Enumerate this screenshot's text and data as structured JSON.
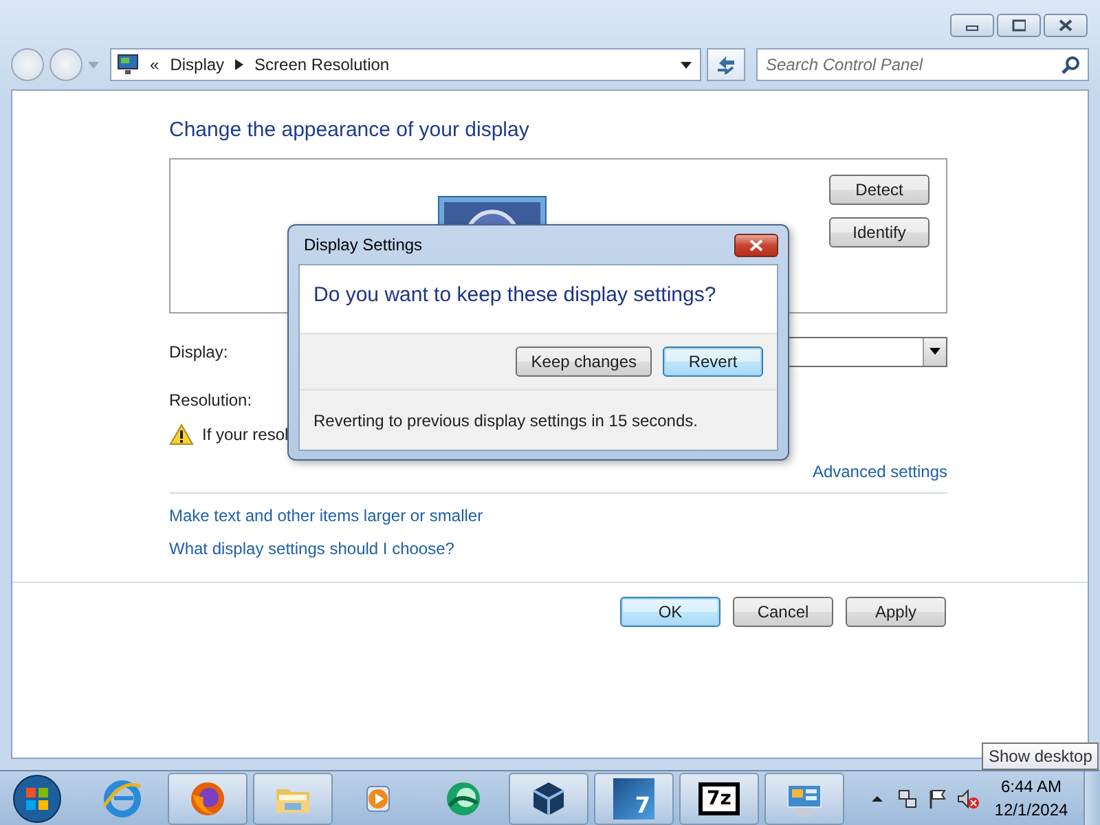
{
  "address_bar": {
    "overflow": "«",
    "breadcrumbs": [
      "Display",
      "Screen Resolution"
    ]
  },
  "search": {
    "placeholder": "Search Control Panel"
  },
  "heading": "Change the appearance of your display",
  "preview_buttons": [
    "Detect",
    "Identify"
  ],
  "fields": [
    {
      "label": "Display:",
      "kind": "dropdown"
    },
    {
      "label": "Resolution:",
      "kind": "plain"
    }
  ],
  "warning": "If your resol",
  "advanced_link": "Advanced settings",
  "links": [
    "Make text and other items larger or smaller",
    "What display settings should I choose?"
  ],
  "buttons": [
    {
      "label": "OK",
      "default": true
    },
    {
      "label": "Cancel",
      "default": false
    },
    {
      "label": "Apply",
      "default": false
    }
  ],
  "dialog": {
    "title": "Display Settings",
    "question": "Do you want to keep these display settings?",
    "buttons": [
      {
        "label": "Keep changes",
        "default": false
      },
      {
        "label": "Revert",
        "default": true
      }
    ],
    "status": "Reverting to previous display settings in 15 seconds."
  },
  "taskbar": {
    "apps": [
      {
        "kind": "ie",
        "running": false
      },
      {
        "kind": "firefox",
        "running": true
      },
      {
        "kind": "explorer",
        "running": true
      },
      {
        "kind": "media",
        "running": false
      },
      {
        "kind": "green",
        "running": false
      },
      {
        "kind": "vbox",
        "running": true
      },
      {
        "kind": "seven",
        "label": "7",
        "running": true
      },
      {
        "kind": "archive",
        "label": "7z",
        "running": true
      },
      {
        "kind": "control",
        "running": true
      }
    ],
    "clock": {
      "time": "6:44 AM",
      "date": "12/1/2024"
    },
    "tooltip": "Show desktop"
  }
}
